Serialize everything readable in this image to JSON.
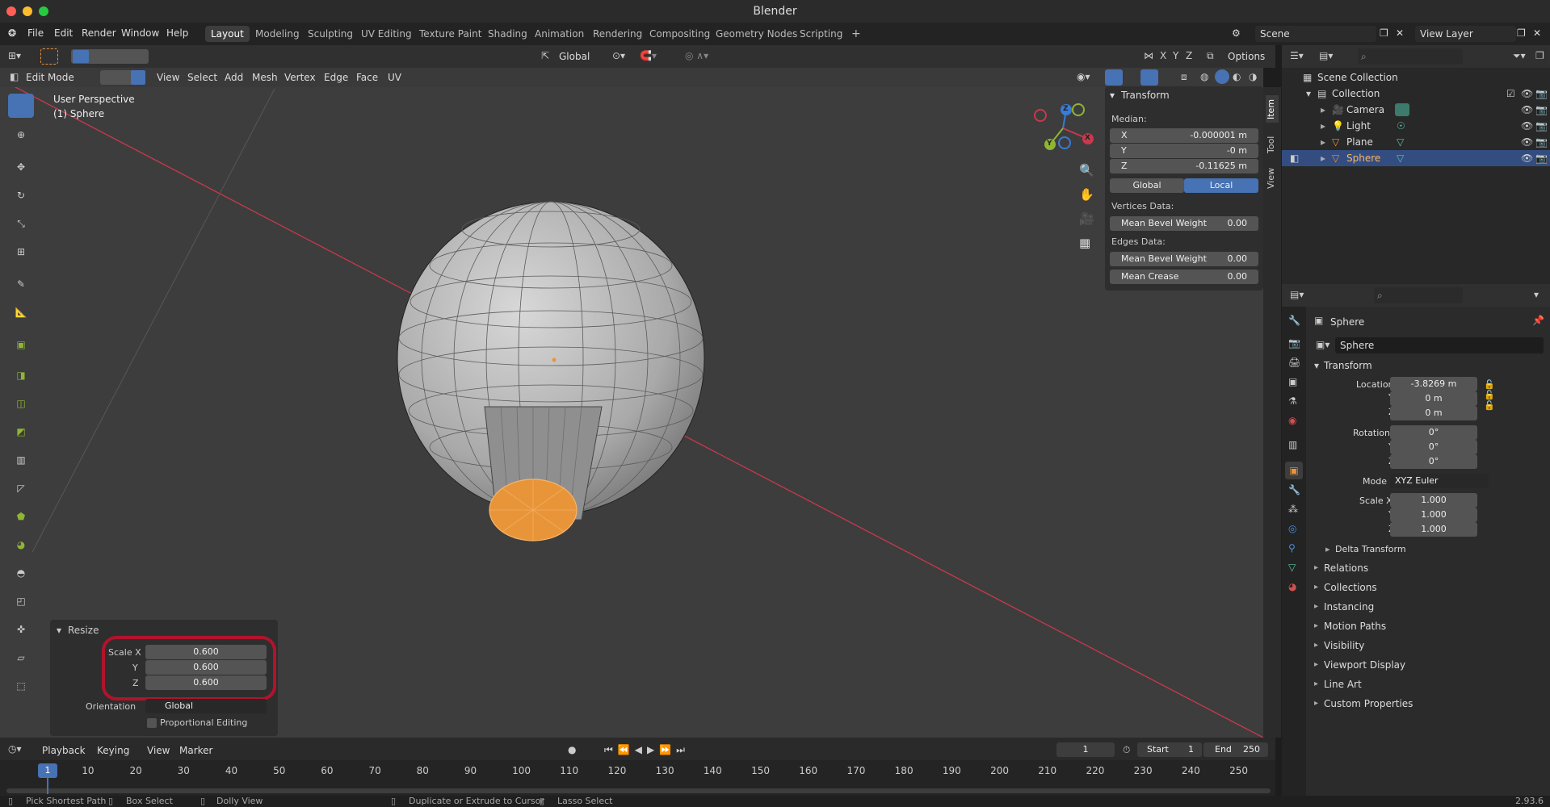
{
  "window": {
    "title": "Blender"
  },
  "topmenu": [
    "File",
    "Edit",
    "Render",
    "Window",
    "Help"
  ],
  "workspaces": [
    "Layout",
    "Modeling",
    "Sculpting",
    "UV Editing",
    "Texture Paint",
    "Shading",
    "Animation",
    "Rendering",
    "Compositing",
    "Geometry Nodes",
    "Scripting"
  ],
  "active_workspace": "Layout",
  "scene_name": "Scene",
  "view_layer": "View Layer",
  "viewport_header": {
    "transform_orientation": "Global",
    "options_label": "Options",
    "axes": [
      "X",
      "Y",
      "Z"
    ]
  },
  "editor_header": {
    "mode": "Edit Mode",
    "menus": [
      "View",
      "Select",
      "Add",
      "Mesh",
      "Vertex",
      "Edge",
      "Face",
      "UV"
    ]
  },
  "viewport": {
    "perspective_label": "User Perspective",
    "object_label": "(1) Sphere",
    "gizmo_axes": [
      "X",
      "Y",
      "Z"
    ]
  },
  "npanel": {
    "title": "Transform",
    "median_label": "Median:",
    "x_label": "X",
    "x_value": "-0.000001 m",
    "y_label": "Y",
    "y_value": "-0 m",
    "z_label": "Z",
    "z_value": "-0.11625 m",
    "space_global": "Global",
    "space_local": "Local",
    "vertices_data_label": "Vertices Data:",
    "vert_bevel_label": "Mean Bevel Weight",
    "vert_bevel_value": "0.00",
    "edges_data_label": "Edges Data:",
    "edge_bevel_label": "Mean Bevel Weight",
    "edge_bevel_value": "0.00",
    "crease_label": "Mean Crease",
    "crease_value": "0.00",
    "tabs": [
      "Item",
      "Tool",
      "View"
    ]
  },
  "redo_panel": {
    "title": "Resize",
    "scale_x_label": "Scale X",
    "scale_x_value": "0.600",
    "scale_y_label": "Y",
    "scale_y_value": "0.600",
    "scale_z_label": "Z",
    "scale_z_value": "0.600",
    "orientation_label": "Orientation",
    "orientation_value": "Global",
    "proportional_label": "Proportional Editing"
  },
  "outliner": {
    "root": "Scene Collection",
    "collection": "Collection",
    "items": [
      "Camera",
      "Light",
      "Plane",
      "Sphere"
    ],
    "selected": "Sphere"
  },
  "properties": {
    "object_name": "Sphere",
    "data_name": "Sphere",
    "transform_label": "Transform",
    "location_x_label": "Location X",
    "location_x": "-3.8269 m",
    "location_y_label": "Y",
    "location_y": "0 m",
    "location_z_label": "Z",
    "location_z": "0 m",
    "rotation_x_label": "Rotation X",
    "rotation_x": "0°",
    "rotation_y_label": "Y",
    "rotation_y": "0°",
    "rotation_z_label": "Z",
    "rotation_z": "0°",
    "mode_label": "Mode",
    "mode_value": "XYZ Euler",
    "scale_x_label": "Scale X",
    "scale_x": "1.000",
    "scale_y_label": "Y",
    "scale_y": "1.000",
    "scale_z_label": "Z",
    "scale_z": "1.000",
    "delta_label": "Delta Transform",
    "sections": [
      "Relations",
      "Collections",
      "Instancing",
      "Motion Paths",
      "Visibility",
      "Viewport Display",
      "Line Art",
      "Custom Properties"
    ]
  },
  "timeline": {
    "menus": [
      "Playback",
      "Keying",
      "View",
      "Marker"
    ],
    "current_frame": "1",
    "start_label": "Start",
    "start": "1",
    "end_label": "End",
    "end": "250",
    "ticks": [
      "1",
      "10",
      "20",
      "30",
      "40",
      "50",
      "60",
      "70",
      "80",
      "90",
      "100",
      "110",
      "120",
      "130",
      "140",
      "150",
      "160",
      "170",
      "180",
      "190",
      "200",
      "210",
      "220",
      "230",
      "240",
      "250"
    ]
  },
  "statusbar": {
    "items": [
      "Pick Shortest Path",
      "Box Select",
      "Dolly View",
      "Duplicate or Extrude to Cursor",
      "Lasso Select"
    ],
    "version": "2.93.6"
  },
  "colors": {
    "accent_blue": "#4772b3",
    "selection_orange": "#e8953a",
    "annotation_red": "#b0142c",
    "x_axis_red": "#c8394c"
  }
}
